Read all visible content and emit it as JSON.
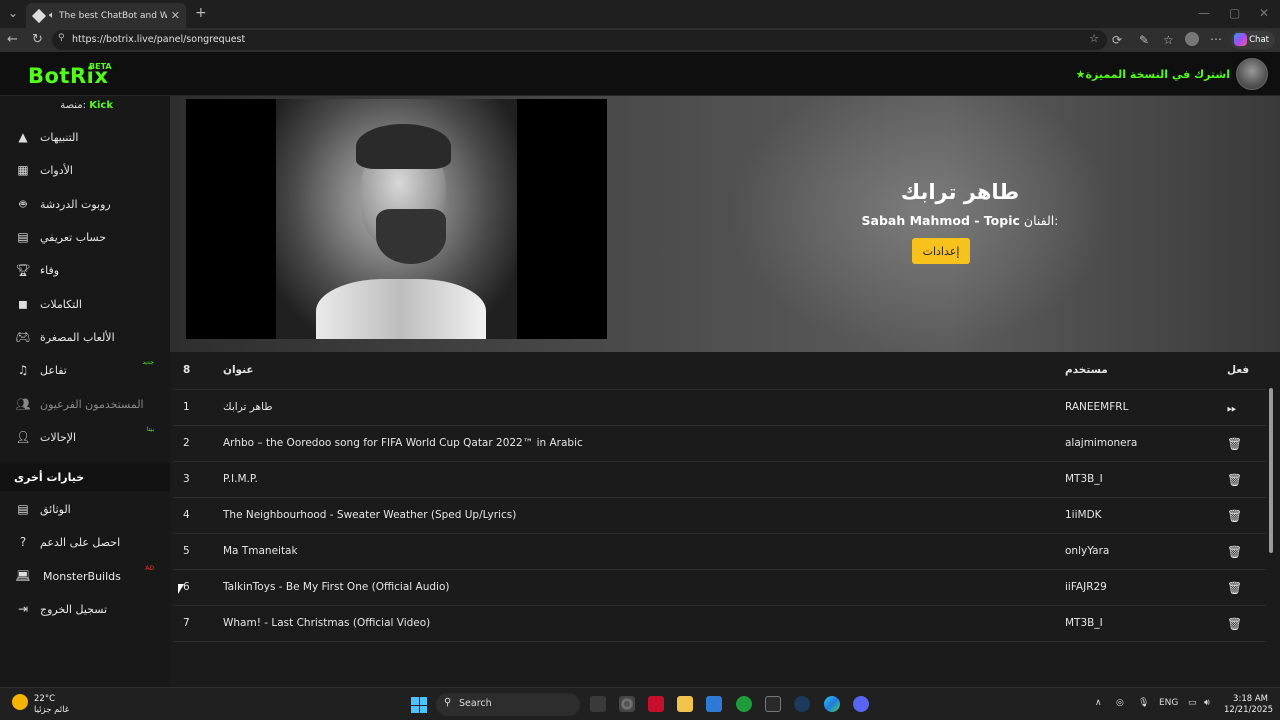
{
  "browser": {
    "tab_title": "The best ChatBot and Widge",
    "url": "https://botrix.live/panel/songrequest",
    "chat_label": "Chat"
  },
  "header": {
    "logo": "BotRix",
    "beta": "BETA",
    "premium": "اشترك في النسخة المميزة"
  },
  "sidebar": {
    "platform_label": "منصة:",
    "platform": "Kick",
    "items": [
      {
        "label": "التنبيهات",
        "icon": "warning-icon"
      },
      {
        "label": "الأدوات",
        "icon": "widgets-icon"
      },
      {
        "label": "روبوت الدردشة",
        "icon": "robot-icon"
      },
      {
        "label": "حساب تعريفي",
        "icon": "id-card-icon"
      },
      {
        "label": "وفاء",
        "icon": "trophy-icon"
      },
      {
        "label": "التكاملات",
        "icon": "cube-icon"
      },
      {
        "label": "الألعاب المصغرة",
        "icon": "gamepad-icon"
      },
      {
        "label": "تفاعل",
        "icon": "music-icon",
        "tag": "جديد"
      },
      {
        "label": "المستخدمون الفرعيون",
        "icon": "users-icon"
      },
      {
        "label": "الإحالات",
        "icon": "user-group-icon",
        "tag": "بيتا"
      }
    ],
    "other_section": "خيارات أخرى",
    "other_items": [
      {
        "label": "الوثائق",
        "icon": "docs-icon"
      },
      {
        "label": "احصل على الدعم",
        "icon": "help-icon"
      },
      {
        "label": "MonsterBuilds",
        "icon": "laptop-icon",
        "tag": "AD"
      },
      {
        "label": "تسجيل الخروج",
        "icon": "logout-icon"
      }
    ]
  },
  "now_playing": {
    "title": "طاهر ترابك",
    "artist_label": "الفنان:",
    "artist": "Sabah Mahmod - Topic",
    "settings_button": "إعدادات"
  },
  "queue": {
    "count": "8",
    "headers": {
      "title": "عنوان",
      "user": "مستخدم",
      "action": "فعل"
    },
    "rows": [
      {
        "num": "1",
        "title": "طاهر ترابك",
        "user": "RANEEMFRL",
        "action": "skip"
      },
      {
        "num": "2",
        "title": "Arhbo – the Ooredoo song for FIFA World Cup Qatar 2022™ in Arabic",
        "user": "alajmimonera",
        "action": "delete"
      },
      {
        "num": "3",
        "title": "P.I.M.P.",
        "user": "MT3B_I",
        "action": "delete"
      },
      {
        "num": "4",
        "title": "The Neighbourhood - Sweater Weather (Sped Up/Lyrics)",
        "user": "1iiMDK",
        "action": "delete"
      },
      {
        "num": "5",
        "title": "Ma Tmaneitak",
        "user": "onlyYara",
        "action": "delete"
      },
      {
        "num": "6",
        "title": "TalkinToys - Be My First One (Official Audio)",
        "user": "iiFAJR29",
        "action": "delete"
      },
      {
        "num": "7",
        "title": "Wham! - Last Christmas (Official Video)",
        "user": "MT3B_I",
        "action": "delete"
      }
    ]
  },
  "taskbar": {
    "temp": "22°C",
    "weather": "غائم جزئيا",
    "search": "Search",
    "lang": "ENG",
    "time": "3:18 AM",
    "date": "12/21/2025"
  }
}
